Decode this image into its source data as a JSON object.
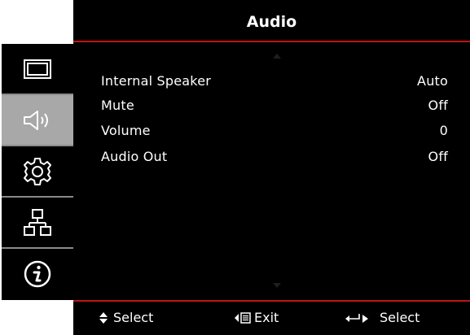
{
  "title": "Audio",
  "sidebar": {
    "items": [
      {
        "icon": "display-icon",
        "active": false
      },
      {
        "icon": "speaker-icon",
        "active": true
      },
      {
        "icon": "gear-icon",
        "active": false
      },
      {
        "icon": "network-icon",
        "active": false
      },
      {
        "icon": "info-icon",
        "active": false
      }
    ]
  },
  "menu": {
    "items": [
      {
        "label": "Internal Speaker",
        "value": "Auto"
      },
      {
        "label": "Mute",
        "value": "Off"
      },
      {
        "label": "Volume",
        "value": "0"
      },
      {
        "label": "Audio Out",
        "value": "Off"
      }
    ]
  },
  "footer": {
    "select_label": "Select",
    "exit_label": "Exit",
    "enter_label": "Select"
  },
  "colors": {
    "accent_line": "#c01414",
    "active_tile": "#a8a8a8",
    "background": "#000000"
  }
}
